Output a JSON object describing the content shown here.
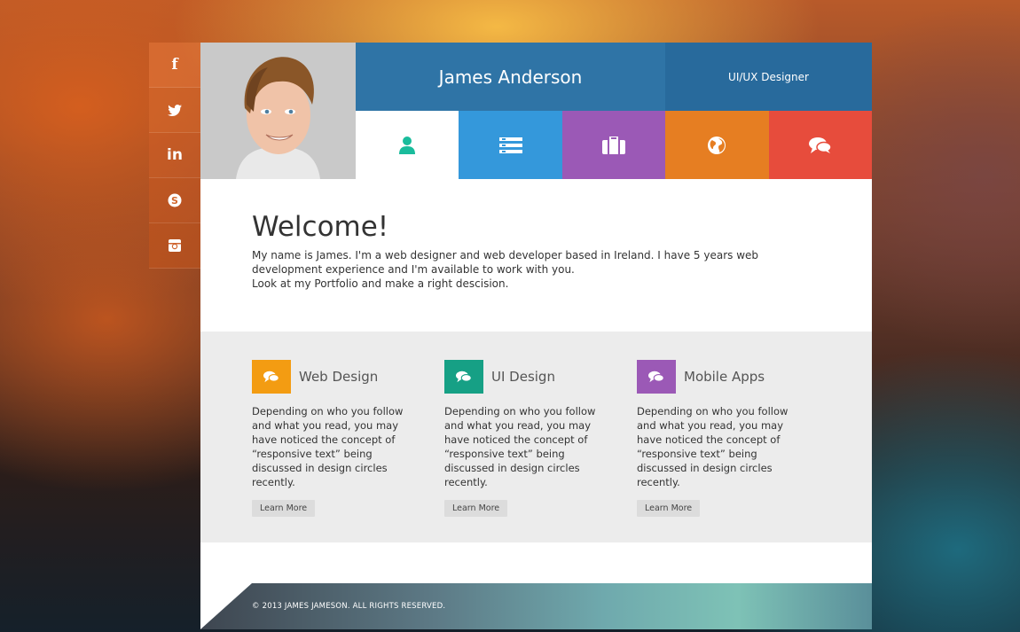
{
  "social": [
    {
      "icon": "facebook-icon",
      "glyph": "f"
    },
    {
      "icon": "twitter-icon",
      "glyph": "t"
    },
    {
      "icon": "linkedin-icon",
      "glyph": "in"
    },
    {
      "icon": "skype-icon",
      "glyph": "s"
    },
    {
      "icon": "instagram-icon",
      "glyph": "i"
    }
  ],
  "profile": {
    "name": "James Anderson",
    "role": "UI/UX Designer"
  },
  "tabs": [
    {
      "icon": "user-icon",
      "color": "#ffffff"
    },
    {
      "icon": "resume-list-icon",
      "color": "#3498db"
    },
    {
      "icon": "briefcase-icon",
      "color": "#9b59b6"
    },
    {
      "icon": "globe-icon",
      "color": "#e67e22"
    },
    {
      "icon": "chat-icon",
      "color": "#e74c3c"
    }
  ],
  "welcome": {
    "heading": "Welcome!",
    "line1": "My name is James. I'm a web designer and web developer based in Ireland. I have 5 years web development experience and I'm available to work with you.",
    "line2": "Look at my Portfolio and make a right descision."
  },
  "services": [
    {
      "title": "Web Design",
      "icon": "chat-icon",
      "color": "#f39c12",
      "text": "Depending on who you follow and what you read, you may have noticed the concept of “responsive text” being discussed in design circles recently.",
      "button": "Learn More"
    },
    {
      "title": "UI Design",
      "icon": "chat-icon",
      "color": "#16a085",
      "text": "Depending on who you follow and what you read, you may have noticed the concept of “responsive text” being discussed in design circles recently.",
      "button": "Learn More"
    },
    {
      "title": "Mobile Apps",
      "icon": "chat-icon",
      "color": "#9b59b6",
      "text": "Depending on who you follow and what you read, you may have noticed the concept of “responsive text” being discussed in design circles recently.",
      "button": "Learn More"
    }
  ],
  "footer": {
    "copyright": "© 2013 JAMES JAMESON. ALL RIGHTS RESERVED."
  }
}
